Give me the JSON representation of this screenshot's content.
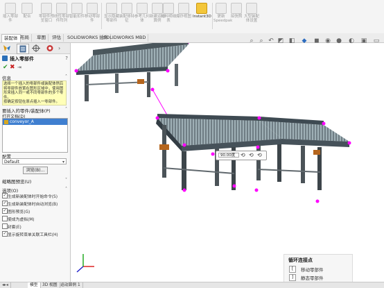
{
  "ribbon": {
    "buttons": [
      {
        "label": "插入零部件",
        "name": "insert-component-button"
      },
      {
        "label": "配合",
        "name": "mate-button"
      },
      {
        "label": "零部件预览窗口",
        "name": "component-preview-button"
      },
      {
        "label": "线性零部件阵列",
        "name": "linear-pattern-button"
      },
      {
        "label": "智能扣件",
        "name": "smart-fasteners-button"
      },
      {
        "label": "移动零部件",
        "name": "move-component-button"
      },
      {
        "label": "显示隐藏零部件",
        "name": "show-hidden-button"
      },
      {
        "label": "装配体特征",
        "name": "assembly-features-button"
      },
      {
        "label": "参考几何体",
        "name": "reference-geometry-button"
      },
      {
        "label": "新建运动算例",
        "name": "new-motion-study-button"
      },
      {
        "label": "材料明细表",
        "name": "bom-button"
      },
      {
        "label": "爆炸视图",
        "name": "exploded-view-button"
      },
      {
        "label": "Instant3D",
        "name": "instant3d-button"
      },
      {
        "label": "更新Speedpak",
        "name": "speedpak-button"
      },
      {
        "label": "拍快照",
        "name": "snapshot-button"
      },
      {
        "label": "大型装配体设置",
        "name": "large-assembly-button"
      }
    ]
  },
  "tabs": [
    "装配体",
    "布局",
    "草图",
    "评估",
    "SOLIDWORKS 插件",
    "SOLIDWORKS MBD"
  ],
  "panel": {
    "title": "插入零部件",
    "info_header": "信息",
    "info_text": "选择一个插入的零部件或装配体然后将零部件放置在图形区域中，使用图形来插入同一或不同零部件的多个零件。",
    "info_text2": "按确定按钮在原点插入一零部件。",
    "part_header": "要插入的零件/装配体(P)",
    "open_docs": "打开文档(D)",
    "doc_item": "conveyor_A",
    "config_header": "配置",
    "config_value": "Default",
    "browse_label": "浏览(B)...",
    "thumb_header": "缩略图预览(U)",
    "options_header": "选项(O)",
    "options": [
      {
        "label": "生成新装配体时开始命令(S)",
        "checked": true
      },
      {
        "label": "生成新装配体时自动浏览(B)",
        "checked": true
      },
      {
        "label": "图形预览(G)",
        "checked": true
      },
      {
        "label": "使成为虚拟(M)",
        "checked": false
      },
      {
        "label": "封套(E)",
        "checked": false
      },
      {
        "label": "显示旋转菜单关联工具栏(H)",
        "checked": true
      }
    ]
  },
  "canvas": {
    "angle_value": "90.00度",
    "popup_title": "循环连接点",
    "popup_items": [
      {
        "key": "[",
        "label": "移动零部件"
      },
      {
        "key": "]",
        "label": "静态零部件"
      }
    ]
  },
  "bottom_tabs": [
    "模型",
    "3D 视图",
    "运动算例 1"
  ],
  "colors": {
    "accent": "#d4a017",
    "magenta": "#ff00ff",
    "info_bg": "#ffffc8"
  }
}
